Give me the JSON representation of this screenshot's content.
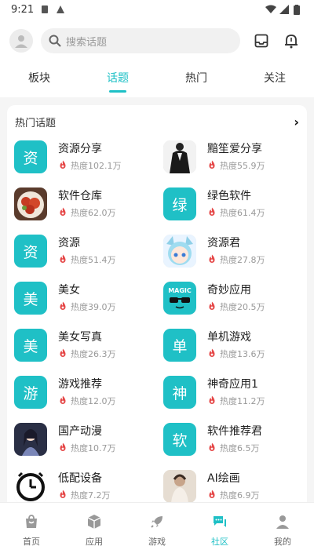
{
  "status": {
    "time": "9:21"
  },
  "search": {
    "placeholder": "搜索话题"
  },
  "tabs": [
    {
      "label": "板块",
      "active": false
    },
    {
      "label": "话题",
      "active": true
    },
    {
      "label": "热门",
      "active": false
    },
    {
      "label": "关注",
      "active": false
    }
  ],
  "card": {
    "title": "热门话题"
  },
  "topics": [
    {
      "name": "资源分享",
      "heat": "热度102.1万",
      "thumb_text": "资",
      "thumb_type": "letter"
    },
    {
      "name": "黯笙爱分享",
      "heat": "热度55.9万",
      "thumb_text": "",
      "thumb_type": "suit-photo"
    },
    {
      "name": "软件仓库",
      "heat": "热度62.0万",
      "thumb_text": "",
      "thumb_type": "food-photo"
    },
    {
      "name": "绿色软件",
      "heat": "热度61.4万",
      "thumb_text": "绿",
      "thumb_type": "letter"
    },
    {
      "name": "资源",
      "heat": "热度51.4万",
      "thumb_text": "资",
      "thumb_type": "letter"
    },
    {
      "name": "资源君",
      "heat": "热度27.8万",
      "thumb_text": "",
      "thumb_type": "anime-photo"
    },
    {
      "name": "美女",
      "heat": "热度39.0万",
      "thumb_text": "美",
      "thumb_type": "letter"
    },
    {
      "name": "奇妙应用",
      "heat": "热度20.5万",
      "thumb_text": "MAGIC",
      "thumb_type": "magic-logo"
    },
    {
      "name": "美女写真",
      "heat": "热度26.3万",
      "thumb_text": "美",
      "thumb_type": "letter"
    },
    {
      "name": "单机游戏",
      "heat": "热度13.6万",
      "thumb_text": "单",
      "thumb_type": "letter"
    },
    {
      "name": "游戏推荐",
      "heat": "热度12.0万",
      "thumb_text": "游",
      "thumb_type": "letter"
    },
    {
      "name": "神奇应用1",
      "heat": "热度11.2万",
      "thumb_text": "神",
      "thumb_type": "letter"
    },
    {
      "name": "国产动漫",
      "heat": "热度10.7万",
      "thumb_text": "",
      "thumb_type": "anime-art"
    },
    {
      "name": "软件推荐君",
      "heat": "热度6.5万",
      "thumb_text": "软",
      "thumb_type": "letter"
    },
    {
      "name": "低配设备",
      "heat": "热度7.2万",
      "thumb_text": "",
      "thumb_type": "clock-icon"
    },
    {
      "name": "AI绘画",
      "heat": "热度6.9万",
      "thumb_text": "",
      "thumb_type": "ai-photo"
    }
  ],
  "nav": [
    {
      "label": "首页",
      "icon": "home-bag-icon",
      "active": false
    },
    {
      "label": "应用",
      "icon": "box-icon",
      "active": false
    },
    {
      "label": "游戏",
      "icon": "rocket-icon",
      "active": false
    },
    {
      "label": "社区",
      "icon": "chat-bubble-icon",
      "active": true
    },
    {
      "label": "我的",
      "icon": "person-icon",
      "active": false
    }
  ],
  "colors": {
    "accent": "#1ec0c6",
    "fire": "#e54848"
  }
}
